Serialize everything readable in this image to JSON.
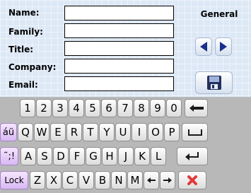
{
  "form": {
    "section_label": "General",
    "fields": [
      {
        "label": "Name:",
        "value": ""
      },
      {
        "label": "Family:",
        "value": ""
      },
      {
        "label": "Title:",
        "value": ""
      },
      {
        "label": "Company:",
        "value": ""
      },
      {
        "label": "Email:",
        "value": ""
      }
    ],
    "icons": {
      "prev": "left-arrow-icon",
      "next": "right-arrow-icon",
      "save": "floppy-disk-icon"
    },
    "colors": {
      "background": "#dde8f6",
      "nav_arrow": "#1a2f8a"
    }
  },
  "keyboard": {
    "rows": [
      [
        "1",
        "2",
        "3",
        "4",
        "5",
        "6",
        "7",
        "8",
        "9",
        "0"
      ],
      [
        "áü",
        "Q",
        "W",
        "E",
        "R",
        "T",
        "Y",
        "U",
        "I",
        "O",
        "P"
      ],
      [
        "˜;!",
        "A",
        "S",
        "D",
        "F",
        "G",
        "H",
        "J",
        "K",
        "L"
      ],
      [
        "Lock",
        "Z",
        "X",
        "C",
        "V",
        "B",
        "N",
        "M"
      ]
    ],
    "special_icons": {
      "backspace": "backspace-icon",
      "space": "space-icon",
      "enter": "enter-icon",
      "cursor_left": "cursor-left-icon",
      "cursor_right": "cursor-right-icon",
      "close": "close-icon"
    },
    "colors": {
      "background": "#b8b8b8",
      "modifier": "#d8b8f4",
      "close": "#e23b3b"
    }
  }
}
